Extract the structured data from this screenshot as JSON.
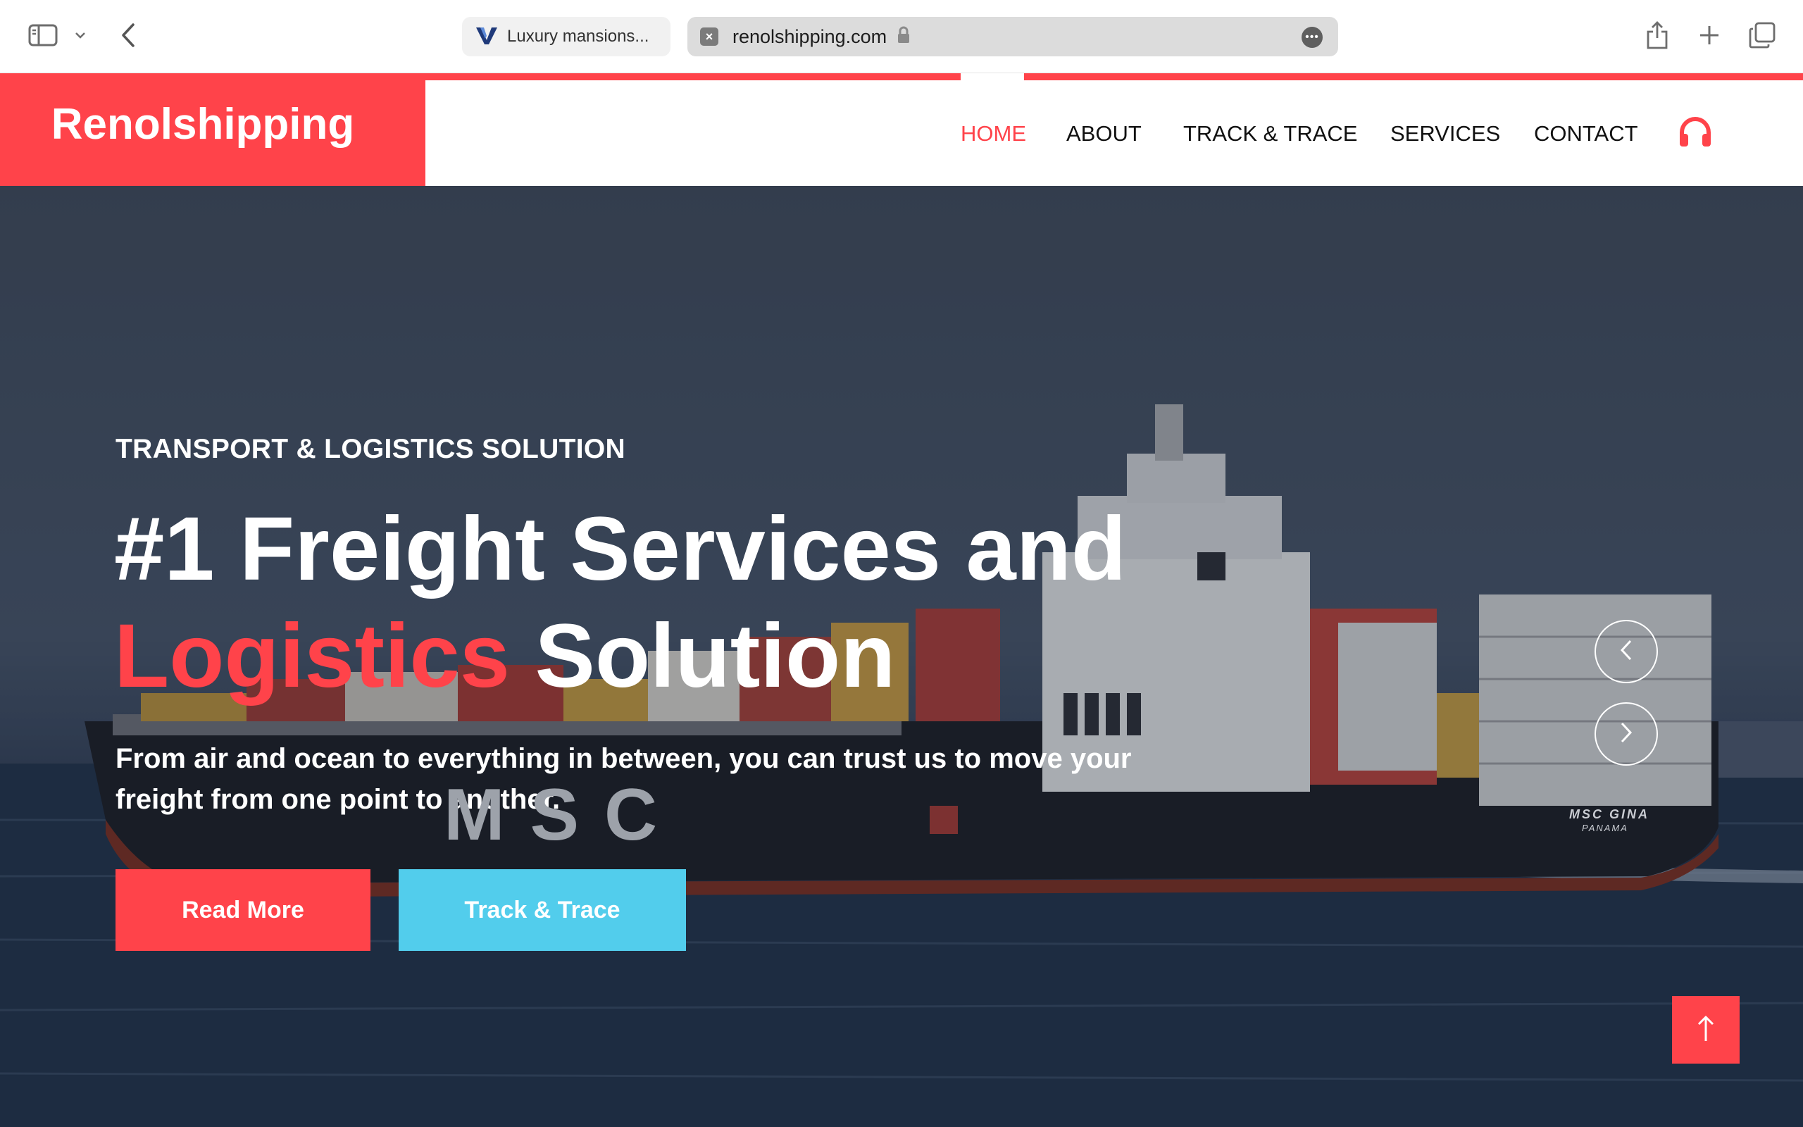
{
  "browser": {
    "tab_inactive_label": "Luxury mansions...",
    "url": "renolshipping.com"
  },
  "site": {
    "brand": "Renolshipping",
    "nav": [
      "HOME",
      "ABOUT",
      "TRACK & TRACE",
      "SERVICES",
      "CONTACT"
    ],
    "active_nav": "HOME",
    "accent_color": "#ff434a",
    "secondary_color": "#52cdec"
  },
  "hero": {
    "eyebrow": "TRANSPORT & LOGISTICS SOLUTION",
    "headline_line1": "#1 Freight Services and",
    "headline_accent": "Logistics",
    "headline_rest": " Solution",
    "lede": "From air and ocean to everything in between, you can trust us to move your freight from one point to another.",
    "primary_button": "Read More",
    "secondary_button": "Track & Trace",
    "ship_hull_text": "MSC",
    "ship_name": "MSC GINA",
    "ship_port": "PANAMA"
  },
  "icons": {
    "sidebar": "sidebar-icon",
    "back": "chevron-left-icon",
    "lock": "lock-icon",
    "share": "share-icon",
    "new_tab": "plus-icon",
    "tabs_overview": "tabs-icon",
    "support": "headphones-icon",
    "scroll_top": "arrow-up-icon"
  }
}
